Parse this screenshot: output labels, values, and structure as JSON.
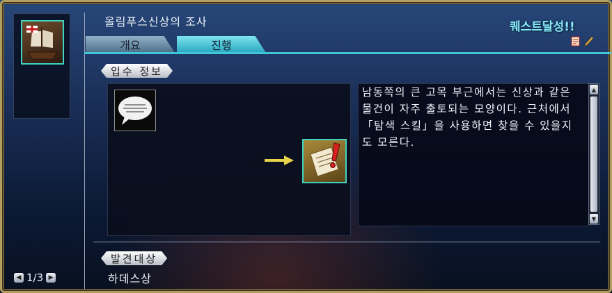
{
  "header": {
    "quest_title": "올림푸스신상의 조사",
    "achieved_label": "퀘스트달성!!"
  },
  "icons": {
    "quest_icon": "ship-icon",
    "memo_icon": "memo-icon",
    "pen_icon": "pen-icon",
    "speech_icon": "speech-bubble-icon",
    "arrow_icon": "arrow-right-icon",
    "doc_icon": "quest-document-icon"
  },
  "tabs": [
    {
      "label": "개요",
      "active": false
    },
    {
      "label": "진행",
      "active": true
    }
  ],
  "acquisition": {
    "label": "입수 정보",
    "description": "남동쪽의 큰 고목 부근에서는 신상과 같은 물건이 자주 출토되는 모양이다. 근처에서 「탐색 스킬」을 사용하면 찾을 수 있을지도 모른다."
  },
  "discovery": {
    "label": "발견대상",
    "target": "하데스상"
  },
  "pager": {
    "text": "1/3"
  },
  "colors": {
    "accent": "#3fc7d9",
    "achieved": "#8ae8ff",
    "frame": "#b29f60"
  }
}
